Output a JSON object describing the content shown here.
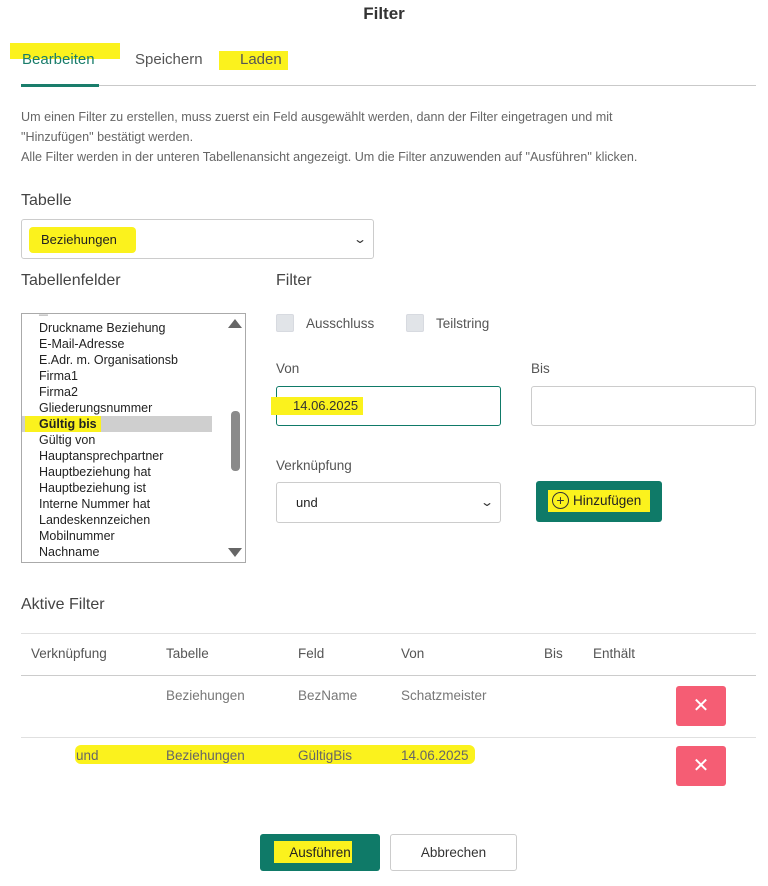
{
  "dialog": {
    "title": "Filter"
  },
  "tabs": [
    {
      "label": "Bearbeiten"
    },
    {
      "label": "Speichern"
    },
    {
      "label": "Laden"
    }
  ],
  "description": {
    "line1": "Um einen Filter zu erstellen, muss zuerst ein Feld ausgewählt werden, dann der Filter eingetragen und mit",
    "line2": "\"Hinzufügen\" bestätigt werden.",
    "line3": "Alle Filter werden in der unteren Tabellenansicht angezeigt. Um die Filter anzuwenden auf \"Ausführen\" klicken."
  },
  "table_section": {
    "label": "Tabelle",
    "selected": "Beziehungen"
  },
  "fields_section": {
    "label": "Tabellenfelder",
    "items": [
      "Druckname Beziehung",
      "E-Mail-Adresse",
      "E.Adr. m. Organisationsb",
      "Firma1",
      "Firma2",
      "Gliederungsnummer",
      "Gültig bis",
      "Gültig von",
      "Hauptansprechpartner",
      "Hauptbeziehung hat",
      "Hauptbeziehung ist",
      "Interne Nummer hat",
      "Landeskennzeichen",
      "Mobilnummer",
      "Nachname"
    ]
  },
  "filter_section": {
    "label": "Filter",
    "exclusion_label": "Ausschluss",
    "substring_label": "Teilstring",
    "from_label": "Von",
    "from_value": "14.06.2025",
    "to_label": "Bis",
    "to_value": "",
    "link_label": "Verknüpfung",
    "link_value": "und",
    "add_label": "Hinzufügen"
  },
  "active_filters": {
    "label": "Aktive Filter",
    "headers": [
      "Verknüpfung",
      "Tabelle",
      "Feld",
      "Von",
      "Bis",
      "Enthält"
    ],
    "rows": [
      {
        "link": "",
        "table": "Beziehungen",
        "field": "BezName",
        "from": "Schatzmeister",
        "to": "",
        "contains": ""
      },
      {
        "link": "und",
        "table": "Beziehungen",
        "field": "GültigBis",
        "from": "14.06.2025",
        "to": "",
        "contains": ""
      }
    ]
  },
  "footer": {
    "run_label": "Ausführen",
    "cancel_label": "Abbrechen"
  },
  "colors": {
    "accent": "#0f7a68",
    "danger": "#f55d74",
    "highlight": "#fbf21d"
  }
}
